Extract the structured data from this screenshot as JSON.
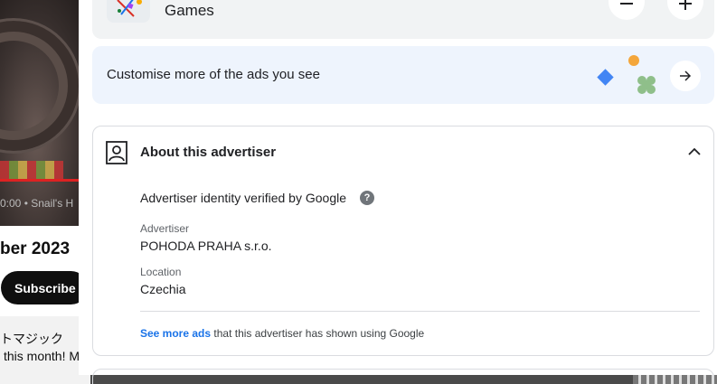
{
  "background": {
    "video_meta": "0:00 • Snail's H",
    "title_fragment": "ber 2023",
    "subscribe_label": "Subscribe",
    "desc_line1": "トマジック",
    "desc_line2": "this month! M"
  },
  "ad_panel": {
    "games": {
      "label": "Games",
      "icon": "games-thumbnail",
      "minus_icon": "minus-icon",
      "plus_icon": "plus-icon"
    },
    "customise": {
      "label": "Customise more of the ads you see",
      "arrow_icon": "arrow-right-icon",
      "colors": {
        "diamond": "#4285f4",
        "dot": "#f4a63b",
        "blob": "#8fbf8a",
        "background": "#eef4fd"
      }
    },
    "about": {
      "title": "About this advertiser",
      "identity_text": "Advertiser identity verified by Google",
      "help_glyph": "?",
      "advertiser_label": "Advertiser",
      "advertiser_value": "POHODA PRAHA s.r.o.",
      "location_label": "Location",
      "location_value": "Czechia",
      "see_more_link": "See more ads",
      "see_more_rest": "that this advertiser has shown using Google",
      "link_color": "#1a73e8"
    }
  }
}
